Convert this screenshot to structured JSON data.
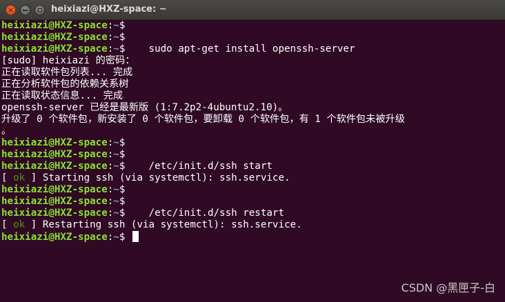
{
  "window": {
    "title": "heixiazi@HXZ-space: ~",
    "close_glyph": "×",
    "accent_close": "#e9541d"
  },
  "terminal": {
    "colors": {
      "background": "#300a24",
      "prompt_user": "#8ae234",
      "prompt_path": "#729fcf",
      "text": "#ffffff",
      "ok": "#4e9a06"
    },
    "lines": [
      {
        "type": "prompt",
        "user": "heixiazi@HXZ-space",
        "sep": ":",
        "path": "~",
        "sign": "$",
        "cmd": ""
      },
      {
        "type": "prompt",
        "user": "heixiazi@HXZ-space",
        "sep": ":",
        "path": "~",
        "sign": "$",
        "cmd": ""
      },
      {
        "type": "prompt",
        "user": "heixiazi@HXZ-space",
        "sep": ":",
        "path": "~",
        "sign": "$",
        "cmd": "    sudo apt-get install openssh-server"
      },
      {
        "type": "text",
        "text": "[sudo] heixiazi 的密码："
      },
      {
        "type": "text",
        "text": "正在读取软件包列表... 完成"
      },
      {
        "type": "text",
        "text": "正在分析软件包的依赖关系树"
      },
      {
        "type": "text",
        "text": "正在读取状态信息... 完成"
      },
      {
        "type": "text",
        "text": "openssh-server 已经是最新版 (1:7.2p2-4ubuntu2.10)。"
      },
      {
        "type": "text",
        "text": "升级了 0 个软件包，新安装了 0 个软件包，要卸载 0 个软件包，有 1 个软件包未被升级"
      },
      {
        "type": "text",
        "text": "。"
      },
      {
        "type": "prompt",
        "user": "heixiazi@HXZ-space",
        "sep": ":",
        "path": "~",
        "sign": "$",
        "cmd": ""
      },
      {
        "type": "prompt",
        "user": "heixiazi@HXZ-space",
        "sep": ":",
        "path": "~",
        "sign": "$",
        "cmd": ""
      },
      {
        "type": "prompt",
        "user": "heixiazi@HXZ-space",
        "sep": ":",
        "path": "~",
        "sign": "$",
        "cmd": "    /etc/init.d/ssh start"
      },
      {
        "type": "status",
        "open": "[ ",
        "ok": "ok",
        "close": " ] ",
        "text": "Starting ssh (via systemctl): ssh.service."
      },
      {
        "type": "prompt",
        "user": "heixiazi@HXZ-space",
        "sep": ":",
        "path": "~",
        "sign": "$",
        "cmd": ""
      },
      {
        "type": "prompt",
        "user": "heixiazi@HXZ-space",
        "sep": ":",
        "path": "~",
        "sign": "$",
        "cmd": ""
      },
      {
        "type": "prompt",
        "user": "heixiazi@HXZ-space",
        "sep": ":",
        "path": "~",
        "sign": "$",
        "cmd": "    /etc/init.d/ssh restart"
      },
      {
        "type": "status",
        "open": "[ ",
        "ok": "ok",
        "close": " ] ",
        "text": "Restarting ssh (via systemctl): ssh.service."
      },
      {
        "type": "prompt",
        "user": "heixiazi@HXZ-space",
        "sep": ":",
        "path": "~",
        "sign": "$",
        "cmd": " ",
        "cursor": true
      }
    ]
  },
  "watermark": "CSDN @黑匣子-白"
}
